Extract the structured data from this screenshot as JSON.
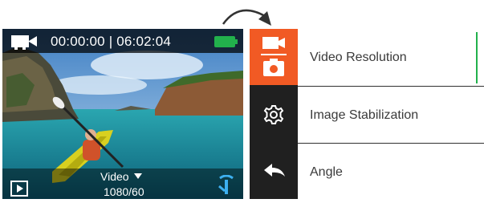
{
  "preview": {
    "timer": "00:00:00 | 06:02:04",
    "mode": "Video",
    "resolution": "1080/60"
  },
  "menu": {
    "items": [
      {
        "label": "Video Resolution",
        "icon": "video-photo-icon",
        "active": true
      },
      {
        "label": "Image Stabilization",
        "icon": "gear-icon",
        "active": false
      },
      {
        "label": "Angle",
        "icon": "back-arrow-icon",
        "active": false
      }
    ]
  },
  "colors": {
    "accent": "#f15a24",
    "battery": "#22b14c",
    "menu_bg": "#202020",
    "indicator": "#22b14c"
  }
}
